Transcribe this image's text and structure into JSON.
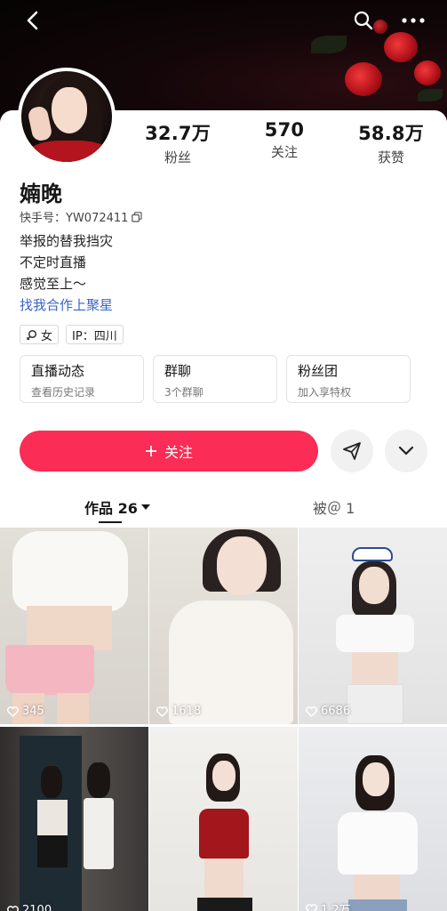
{
  "nav": {
    "back_icon": "back-icon",
    "search_icon": "search-icon",
    "more_icon": "more-icon"
  },
  "profile": {
    "name": "婻晚",
    "uid_label": "快手号：YW072411",
    "bio_lines": [
      "举报的替我挡灾",
      "不定时直播",
      "感觉至上～"
    ],
    "bio_link": "找我合作上聚星",
    "tags": {
      "gender": "女",
      "ip": "IP：四川"
    }
  },
  "stats": [
    {
      "value": "32.7万",
      "label": "粉丝"
    },
    {
      "value": "570",
      "label": "关注"
    },
    {
      "value": "58.8万",
      "label": "获赞"
    }
  ],
  "entries": [
    {
      "title": "直播动态",
      "subtitle": "查看历史记录"
    },
    {
      "title": "群聊",
      "subtitle": "3个群聊"
    },
    {
      "title": "粉丝团",
      "subtitle": "加入享特权"
    }
  ],
  "actions": {
    "follow_label": "关注"
  },
  "tabs": {
    "works": "作品 26",
    "mentions": "被＠ 1"
  },
  "grid": [
    {
      "likes": "345",
      "bg": "#ece9e6"
    },
    {
      "likes": "1618",
      "bg": "#e9e7e2"
    },
    {
      "likes": "6686",
      "bg": "#ebebeb"
    },
    {
      "likes": "2100",
      "bg": "#3d3b3a"
    },
    {
      "likes": "",
      "bg": "#f0efec"
    },
    {
      "likes": "1.2万",
      "bg": "#e7e8ea"
    }
  ],
  "colors": {
    "accent": "#fb2c55",
    "link": "#3a64c8"
  }
}
